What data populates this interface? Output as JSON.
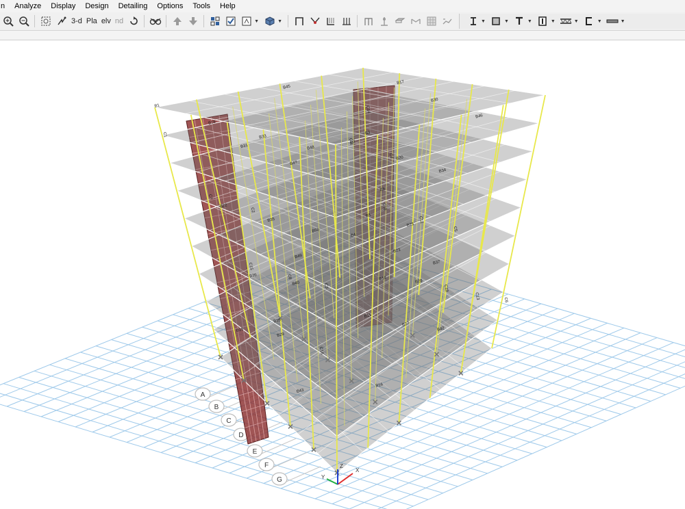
{
  "menu": {
    "items": [
      "n",
      "Analyze",
      "Display",
      "Design",
      "Detailing",
      "Options",
      "Tools",
      "Help"
    ]
  },
  "toolbar": {
    "view_3d": "3-d",
    "view_plan": "Pla",
    "view_elev": "elv",
    "view_nd": "nd"
  },
  "viewport": {
    "grid_labels": [
      "A",
      "B",
      "C",
      "D",
      "E",
      "F",
      "G"
    ],
    "column_labels": [
      "C1",
      "C2",
      "C3",
      "C4",
      "C5",
      "C6",
      "C7",
      "C8",
      "C11",
      "C12",
      "C13",
      "C14",
      "C15",
      "C16",
      "C18",
      "C19"
    ],
    "beam_labels": [
      "B1",
      "B2",
      "B3",
      "B4",
      "B5",
      "B8",
      "B11",
      "B14",
      "B15",
      "B16",
      "B17",
      "B18",
      "B20",
      "B22",
      "B23",
      "B25",
      "B26",
      "B27",
      "B28",
      "B29",
      "B30",
      "B31",
      "B33",
      "B34",
      "B35",
      "B37",
      "B39",
      "B40",
      "B42",
      "B43",
      "B45",
      "B46",
      "B47",
      "B48",
      "B49",
      "B50"
    ],
    "colors": {
      "slab": "#6e6e6e",
      "column": "#e8e84a",
      "shear_wall": "#8b2f2f",
      "grid": "#9ec9ea",
      "grid_bubble": "#bdbdbd"
    },
    "storeys": 10,
    "axes": [
      "X",
      "Y",
      "Z"
    ]
  }
}
